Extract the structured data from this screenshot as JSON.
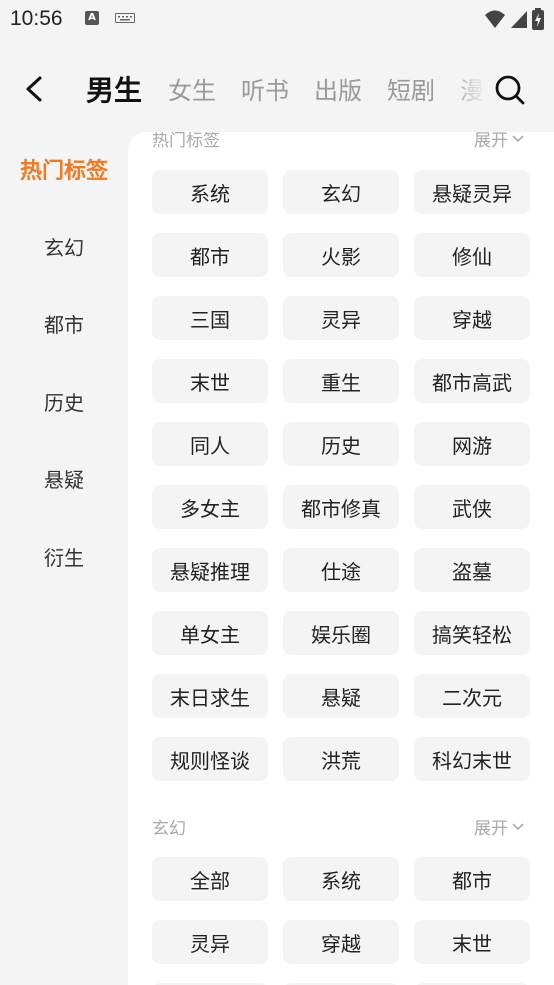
{
  "status": {
    "time": "10:56"
  },
  "nav": {
    "tabs": [
      {
        "label": "男生",
        "active": true
      },
      {
        "label": "女生"
      },
      {
        "label": "听书"
      },
      {
        "label": "出版"
      },
      {
        "label": "短剧"
      },
      {
        "label": "漫"
      }
    ]
  },
  "sidebar": {
    "items": [
      {
        "label": "热门标签",
        "active": true
      },
      {
        "label": "玄幻"
      },
      {
        "label": "都市"
      },
      {
        "label": "历史"
      },
      {
        "label": "悬疑"
      },
      {
        "label": "衍生"
      }
    ]
  },
  "sections": [
    {
      "title": "热门标签",
      "expand": "展开",
      "tags": [
        "系统",
        "玄幻",
        "悬疑灵异",
        "都市",
        "火影",
        "修仙",
        "三国",
        "灵异",
        "穿越",
        "末世",
        "重生",
        "都市高武",
        "同人",
        "历史",
        "网游",
        "多女主",
        "都市修真",
        "武侠",
        "悬疑推理",
        "仕途",
        "盗墓",
        "单女主",
        "娱乐圈",
        "搞笑轻松",
        "末日求生",
        "悬疑",
        "二次元",
        "规则怪谈",
        "洪荒",
        "科幻末世"
      ]
    },
    {
      "title": "玄幻",
      "expand": "展开",
      "tags": [
        "全部",
        "系统",
        "都市",
        "灵异",
        "穿越",
        "末世",
        "",
        "",
        ""
      ]
    }
  ],
  "colors": {
    "accent": "#f07a22",
    "tag_bg": "#f4f4f4"
  },
  "icons": [
    "back-arrow-icon",
    "search-icon",
    "chevron-down-icon",
    "wifi-icon",
    "signal-icon",
    "battery-icon"
  ]
}
